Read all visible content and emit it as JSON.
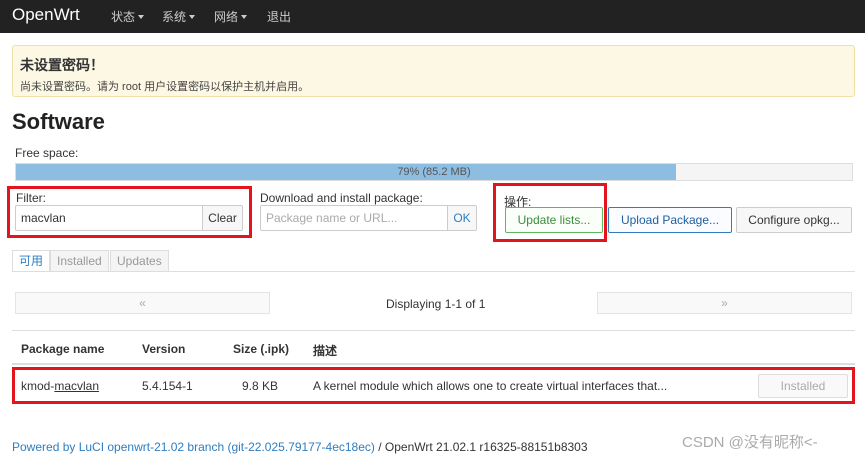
{
  "navbar": {
    "brand": "OpenWrt",
    "items": [
      {
        "label": "状态",
        "dropdown": true
      },
      {
        "label": "系统",
        "dropdown": true
      },
      {
        "label": "网络",
        "dropdown": true
      },
      {
        "label": "退出",
        "dropdown": false
      }
    ]
  },
  "alert": {
    "title": "未设置密码！",
    "body": "尚未设置密码。请为 root 用户设置密码以保护主机并启用。"
  },
  "page": {
    "title": "Software"
  },
  "free_space": {
    "label": "Free space:",
    "percent": 79,
    "text": "79% (85.2 MB)"
  },
  "filter": {
    "label": "Filter:",
    "value": "macvlan",
    "clear_label": "Clear"
  },
  "download": {
    "label": "Download and install package:",
    "placeholder": "Package name or URL...",
    "ok_label": "OK"
  },
  "actions": {
    "label": "操作:",
    "update_label": "Update lists...",
    "upload_label": "Upload Package...",
    "configure_label": "Configure opkg..."
  },
  "tabs": [
    {
      "label": "可用",
      "active": true
    },
    {
      "label": "Installed",
      "active": false
    },
    {
      "label": "Updates",
      "active": false
    }
  ],
  "pager": {
    "prev": "«",
    "next": "»",
    "text": "Displaying 1-1 of 1"
  },
  "table": {
    "headers": [
      "Package name",
      "Version",
      "Size (.ipk)",
      "描述"
    ],
    "rows": [
      {
        "name_prefix": "kmod-",
        "name_link": "macvlan",
        "version": "5.4.154-1",
        "size": "9.8 KB",
        "description": "A kernel module which allows one to create virtual interfaces that...",
        "status": "Installed"
      }
    ]
  },
  "footer": {
    "link": "Powered by LuCI openwrt-21.02 branch (git-22.025.79177-4ec18ec)",
    "text": " / OpenWrt 21.02.1 r16325-88151b8303"
  },
  "watermark": "CSDN @没有昵称<-",
  "colors": {
    "navbar": "#222222",
    "alert_bg": "#fcf8e3",
    "progress_fill": "#8ebde2",
    "highlight": "#e3141d",
    "link": "#2f7dbf"
  }
}
